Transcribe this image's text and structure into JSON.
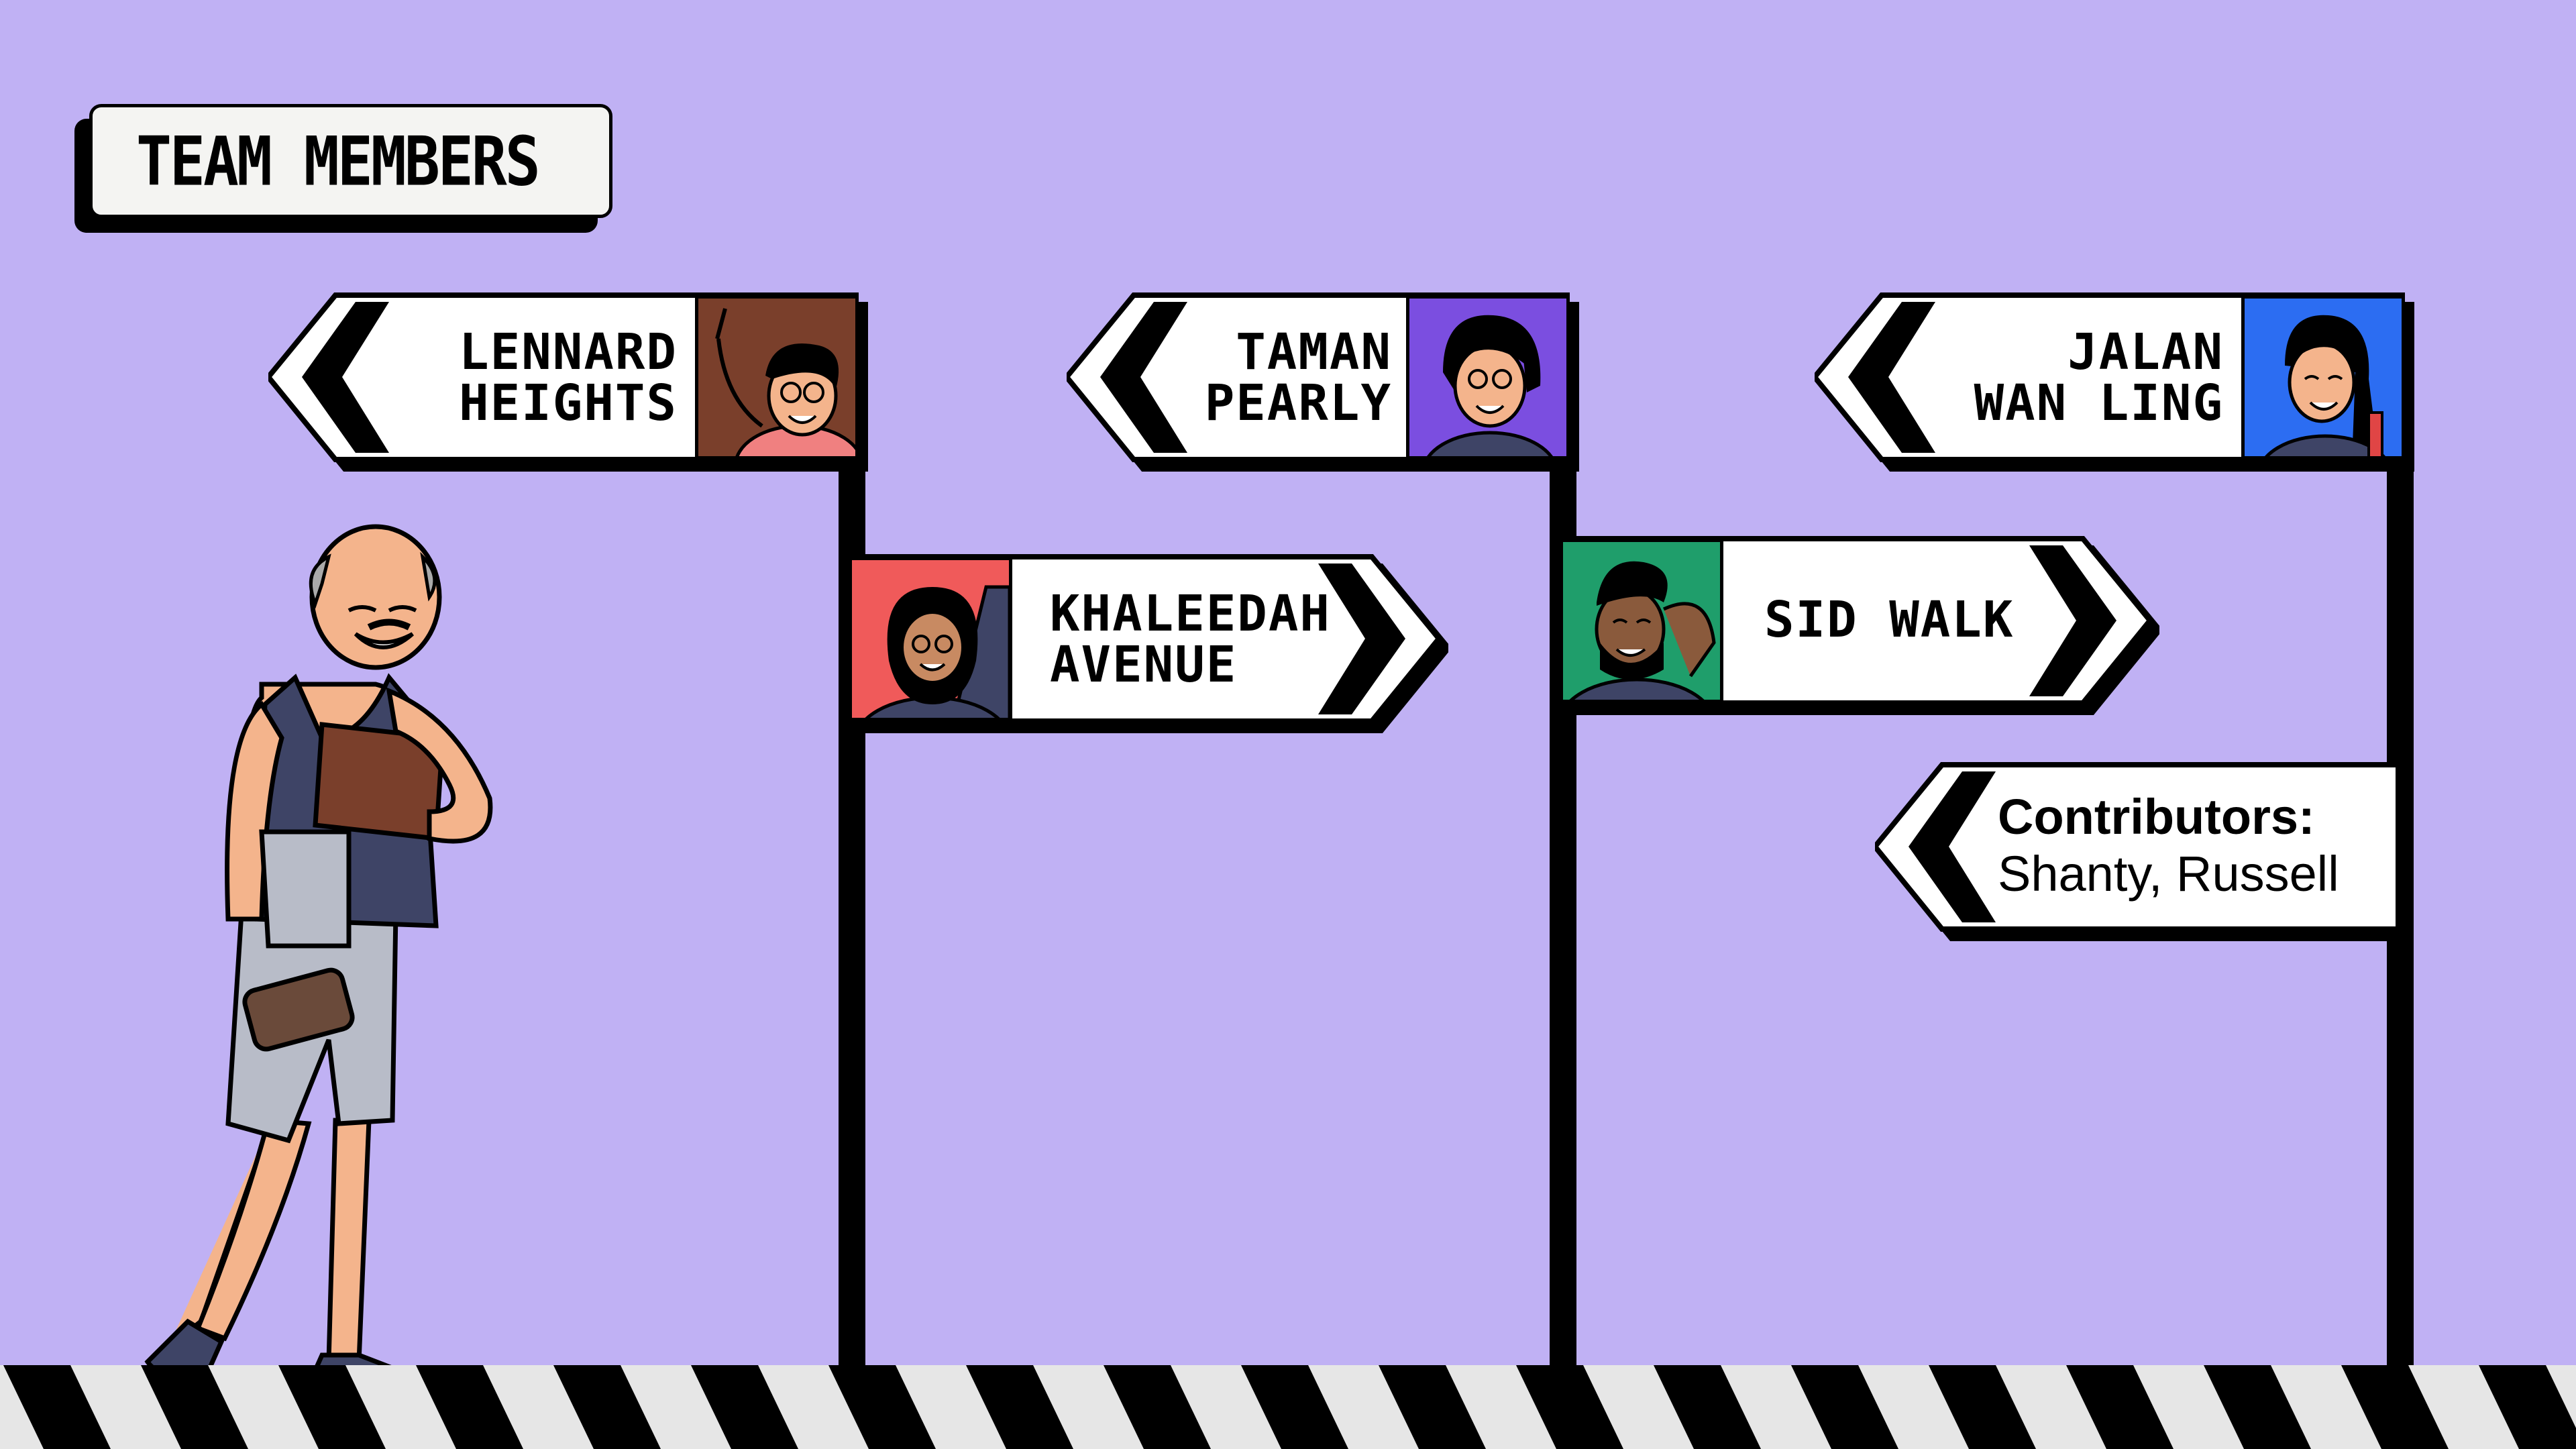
{
  "title": "TEAM MEMBERS",
  "signs": [
    {
      "line1": "LENNARD",
      "line2": "HEIGHTS",
      "direction": "left",
      "avatar_bg": "#7a3f2b"
    },
    {
      "line1": "TAMAN",
      "line2": "PEARLY",
      "direction": "left",
      "avatar_bg": "#7b4ee0"
    },
    {
      "line1": "JALAN",
      "line2": "WAN LING",
      "direction": "left",
      "avatar_bg": "#2c6df2"
    },
    {
      "line1": "KHALEEDAH",
      "line2": "AVENUE",
      "direction": "right",
      "avatar_bg": "#f05a5a"
    },
    {
      "line1": "SID WALK",
      "line2": "",
      "direction": "right",
      "avatar_bg": "#1f9e6b"
    }
  ],
  "contributors": {
    "label": "Contributors:",
    "names": "Shanty, Russell"
  },
  "colors": {
    "background": "#c0b1f4",
    "sign": "#ffffff",
    "outline": "#000000",
    "crosswalk_light": "#e6e6e6"
  }
}
